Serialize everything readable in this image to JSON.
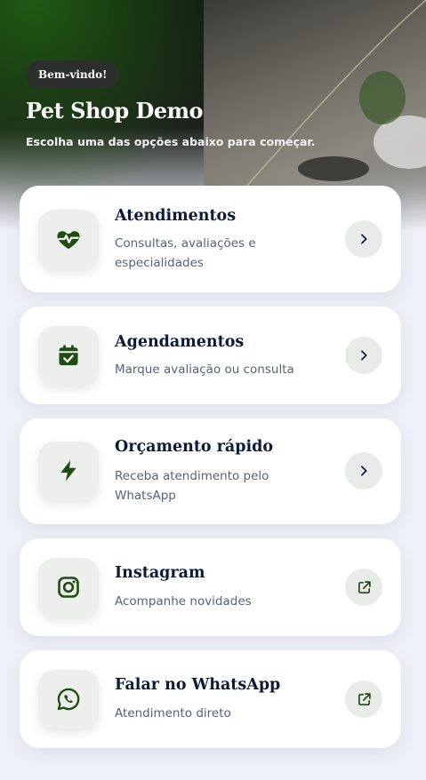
{
  "header": {
    "badge": "Bem-vindo!",
    "title": "Pet Shop Demo",
    "subtitle": "Escolha uma das opções abaixo para começar."
  },
  "colors": {
    "accent": "#1f4d10",
    "title": "#0d1b3a",
    "muted": "#56627a"
  },
  "cards": [
    {
      "title": "Atendimentos",
      "desc": "Consultas, avaliações e especialidades",
      "icon": "heart-pulse-icon",
      "action_icon": "chevron-right-icon"
    },
    {
      "title": "Agendamentos",
      "desc": "Marque avaliação ou consulta",
      "icon": "calendar-check-icon",
      "action_icon": "chevron-right-icon"
    },
    {
      "title": "Orçamento rápido",
      "desc": "Receba atendimento pelo WhatsApp",
      "icon": "lightning-icon",
      "action_icon": "chevron-right-icon"
    },
    {
      "title": "Instagram",
      "desc": "Acompanhe novidades",
      "icon": "instagram-icon",
      "action_icon": "external-link-icon"
    },
    {
      "title": "Falar no WhatsApp",
      "desc": "Atendimento direto",
      "icon": "whatsapp-icon",
      "action_icon": "external-link-icon"
    }
  ]
}
